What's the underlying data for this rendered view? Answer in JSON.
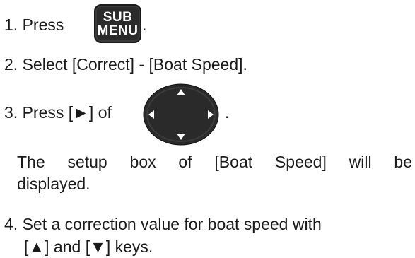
{
  "steps": {
    "step1_prefix": "1. Press",
    "step1_suffix": ".",
    "step2": "2. Select [Correct] - [Boat Speed].",
    "step3_prefix": "3. Press [►] of",
    "step3_suffix": ".",
    "step3_note_line1": "The setup box of [Boat Speed] will be",
    "step3_note_line2": "displayed.",
    "step4_line1": "4. Set a correction value for boat speed with",
    "step4_line2": "[▲] and [▼] keys."
  },
  "keys": {
    "sub_menu_top": "SUB",
    "sub_menu_bottom": "MENU"
  },
  "icons": {
    "sub_menu_key": "sub-menu-key-icon",
    "cursor_pad": "cursor-pad-icon"
  },
  "colors": {
    "key_fill": "#2b2b2b",
    "text": "#1a1a1a"
  }
}
